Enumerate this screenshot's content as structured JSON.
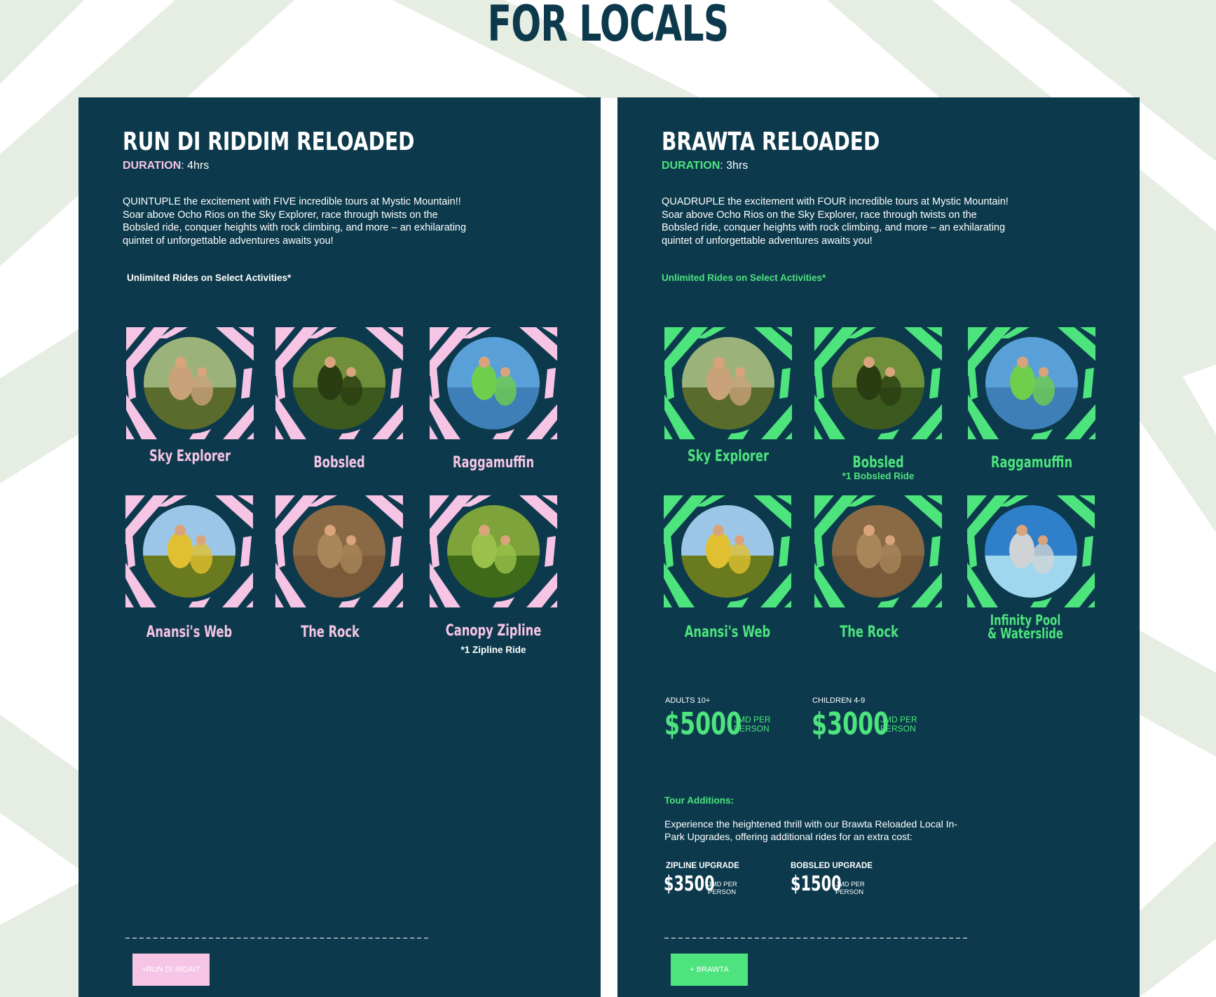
{
  "page": {
    "title": "FOR LOCALS"
  },
  "colors": {
    "navy": "#0c3a4c",
    "pink": "#f6c4e4",
    "green": "#4de37d",
    "background_stripes": "#e6ede2"
  },
  "tours": [
    {
      "title": "RUN DI RIDDIM RELOADED",
      "duration_label": "DURATION",
      "duration_value": ": 4hrs",
      "description": "QUINTUPLE the excitement with FIVE incredible tours at Mystic Mountain!! Soar above Ocho Rios on the Sky Explorer, race through twists on the Bobsled ride, conquer heights with rock climbing, and more – an exhilarating quintet of unforgettable adventures awaits you!",
      "unlimited_text": "Unlimited Rides on Select Activities*",
      "activities": [
        {
          "name": "Sky Explorer",
          "note": "",
          "photo_icon": "chairlift-photo"
        },
        {
          "name": "Bobsled",
          "note": "",
          "photo_icon": "bobsled-photo"
        },
        {
          "name": "Raggamuffin",
          "note": "",
          "photo_icon": "swing-ride-photo"
        },
        {
          "name": "Anansi's Web",
          "note": "",
          "photo_icon": "ropes-course-photo"
        },
        {
          "name": "The Rock",
          "note": "",
          "photo_icon": "climbing-wall-photo"
        },
        {
          "name": "Canopy Zipline",
          "note": "*1 Zipline Ride",
          "photo_icon": "zipline-photo"
        }
      ],
      "cta_label": "+RUN DI RIDAIT"
    },
    {
      "title": "BRAWTA RELOADED",
      "duration_label": "DURATION",
      "duration_value": ": 3hrs",
      "description": "QUADRUPLE the excitement with FOUR incredible tours at Mystic Mountain! Soar above Ocho Rios on the Sky Explorer, race through twists on the Bobsled ride, conquer heights with rock climbing, and more – an exhilarating quintet of unforgettable adventures awaits you!",
      "unlimited_text": "Unlimited Rides on Select Activities*",
      "activities": [
        {
          "name": "Sky Explorer",
          "note": "",
          "photo_icon": "chairlift-photo"
        },
        {
          "name": "Bobsled",
          "note": "*1 Bobsled Ride",
          "photo_icon": "bobsled-photo"
        },
        {
          "name": "Raggamuffin",
          "note": "",
          "photo_icon": "swing-ride-photo"
        },
        {
          "name": "Anansi's Web",
          "note": "",
          "photo_icon": "ropes-course-photo"
        },
        {
          "name": "The Rock",
          "note": "",
          "photo_icon": "climbing-wall-photo"
        },
        {
          "name": "Infinity Pool",
          "name_line2": "& Waterslide",
          "note": "",
          "photo_icon": "waterslide-photo"
        }
      ],
      "prices": [
        {
          "label": "ADULTS 10+",
          "amount": "$5000",
          "unit_line1": "JMD PER",
          "unit_line2": "PERSON"
        },
        {
          "label": "CHILDREN 4-9",
          "amount": "$3000",
          "unit_line1": "JMD PER",
          "unit_line2": "PERSON"
        }
      ],
      "additions_heading": "Tour Additions:",
      "additions_text": "Experience the heightened thrill with our Brawta Reloaded Local In-Park Upgrades, offering additional rides for an extra cost:",
      "upgrades": [
        {
          "label": "ZIPLINE UPGRADE",
          "amount": "$3500",
          "unit_line1": "JMD PER",
          "unit_line2": "PERSON"
        },
        {
          "label": "BOBSLED UPGRADE",
          "amount": "$1500",
          "unit_line1": "JMD PER",
          "unit_line2": "PERSON"
        }
      ],
      "cta_label": "+ BRAWTA"
    }
  ]
}
